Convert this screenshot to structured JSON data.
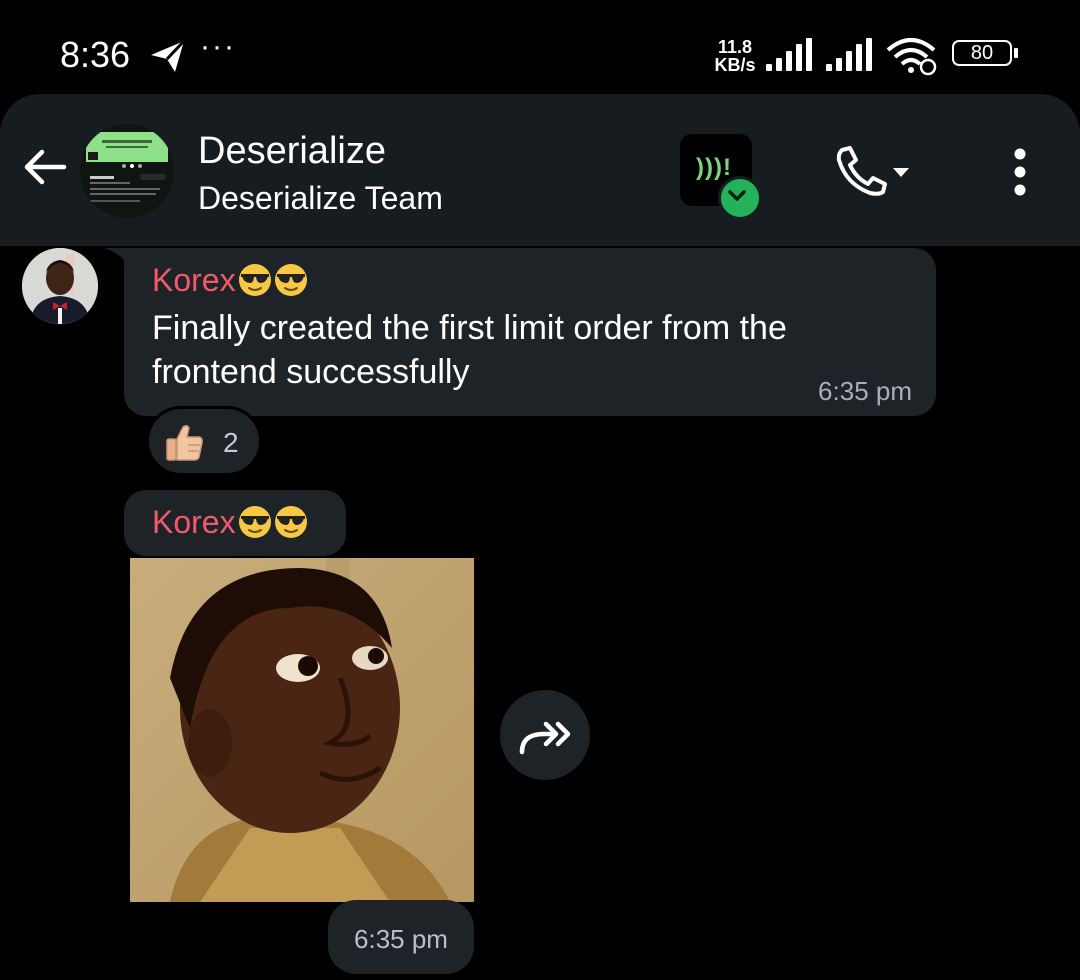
{
  "status_bar": {
    "time": "8:36",
    "more_indicator": "···",
    "net_speed_value": "11.8",
    "net_speed_unit": "KB/s",
    "battery_level": "80",
    "icons": [
      "telegram-send-icon",
      "signal-bars-icon",
      "signal-bars-icon",
      "wifi-icon",
      "battery-icon"
    ]
  },
  "header": {
    "title": "Deserialize",
    "subtitle": "Deserialize Team",
    "voice_badge_text": ")))!",
    "icons": [
      "back-arrow-icon",
      "group-avatar",
      "voice-chat-icon",
      "phone-icon",
      "dropdown-caret-icon",
      "more-vertical-icon"
    ]
  },
  "messages": [
    {
      "sender": "Korex",
      "sender_emoji": "smiling-face-with-sunglasses",
      "text": "Finally created the first limit order from the frontend successfully",
      "time": "6:35 pm",
      "reaction": {
        "emoji": "thumbs-up",
        "count": "2"
      }
    },
    {
      "sender": "Korex",
      "sender_emoji": "smiling-face-with-sunglasses",
      "type": "photo",
      "time": "6:35 pm",
      "forward_icon": "forward-share-icon"
    }
  ],
  "colors": {
    "background": "#000000",
    "header_bg": "#171c21",
    "bubble_bg": "#1e2327",
    "sender_name": "#f05a6a",
    "timestamp": "#a7b0b8",
    "voice_accent": "#7cd67a",
    "check_green": "#22b35a"
  }
}
